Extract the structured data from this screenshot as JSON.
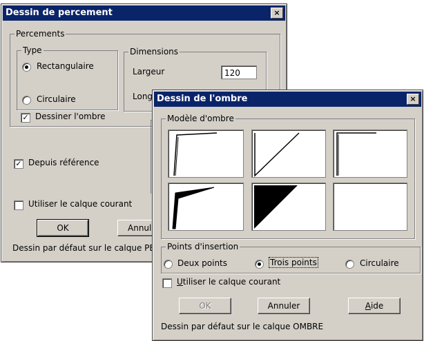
{
  "back_dialog": {
    "title": "Dessin de percement",
    "close_label": "×",
    "percements_group": "Percements",
    "type_group": "Type",
    "radio_rect": "Rectangulaire",
    "radio_circ": "Circulaire",
    "dimensions_group": "Dimensions",
    "largeur_label": "Largeur",
    "largeur_value": "120",
    "longueur_label": "Long",
    "dessiner_ombre": "Dessiner l'ombre",
    "depuis_reference": "Depuis référence",
    "utiliser_calque": "Utiliser le calque courant",
    "ok_label": "OK",
    "annuler_label": "Annul",
    "status": "Dessin par défaut sur le calque PE"
  },
  "front_dialog": {
    "title": "Dessin de l'ombre",
    "close_label": "×",
    "modele_group": "Modèle d'ombre",
    "points_group": "Points d'insertion",
    "radio_deux": "Deux points",
    "radio_trois": "Trois points",
    "radio_circ": "Circulaire",
    "utiliser_calque_u": "U",
    "utiliser_calque_rest": "tiliser le calque courant",
    "ok_label": "OK",
    "annuler_label": "Annuler",
    "aide_u": "A",
    "aide_rest": "ide",
    "status": "Dessin par défaut sur le calque OMBRE"
  }
}
